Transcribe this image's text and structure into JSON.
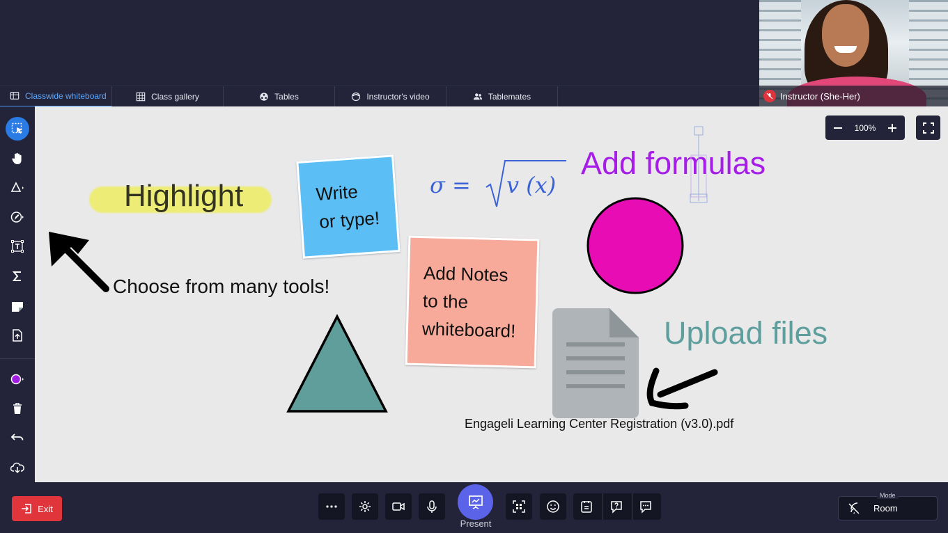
{
  "tabs": [
    {
      "label": "Classwide whiteboard",
      "icon": "whiteboard-icon"
    },
    {
      "label": "Class gallery",
      "icon": "grid-icon"
    },
    {
      "label": "Tables",
      "icon": "tables-icon"
    },
    {
      "label": "Instructor's video",
      "icon": "instructor-icon"
    },
    {
      "label": "Tablemates",
      "icon": "people-icon"
    }
  ],
  "video": {
    "caption": "Instructor (She-Her)"
  },
  "zoom": {
    "level": "100%"
  },
  "whiteboard": {
    "highlight": "Highlight",
    "choose": "Choose from many tools!",
    "note_blue": {
      "line1": "Write",
      "line2": "or type!",
      "color": "#5bbff6"
    },
    "note_salmon": {
      "line1": "Add Notes",
      "line2": "to the",
      "line3": "whiteboard!",
      "color": "#f7a99a"
    },
    "formula": {
      "lhs": "σ",
      "eq": "=",
      "arg": "v (x)"
    },
    "add_formulas": "Add formulas",
    "upload_files": "Upload files",
    "file_name": "Engageli Learning Center Registration (v3.0).pdf",
    "circle_color": "#e80cb5",
    "triangle_color": "#5f9e9a",
    "formula_color": "#3a62d8",
    "add_formulas_color": "#a61de8",
    "upload_color": "#5e9f9d"
  },
  "tools": [
    "select-icon",
    "hand-icon",
    "shapes-icon",
    "pen-icon",
    "text-icon",
    "formula-icon",
    "note-icon",
    "upload-icon",
    "color-icon",
    "trash-icon",
    "undo-icon",
    "download-icon"
  ],
  "bottom": {
    "exit_label": "Exit",
    "present_label": "Present",
    "mode_label": "Mode",
    "mode_value": "Room"
  }
}
